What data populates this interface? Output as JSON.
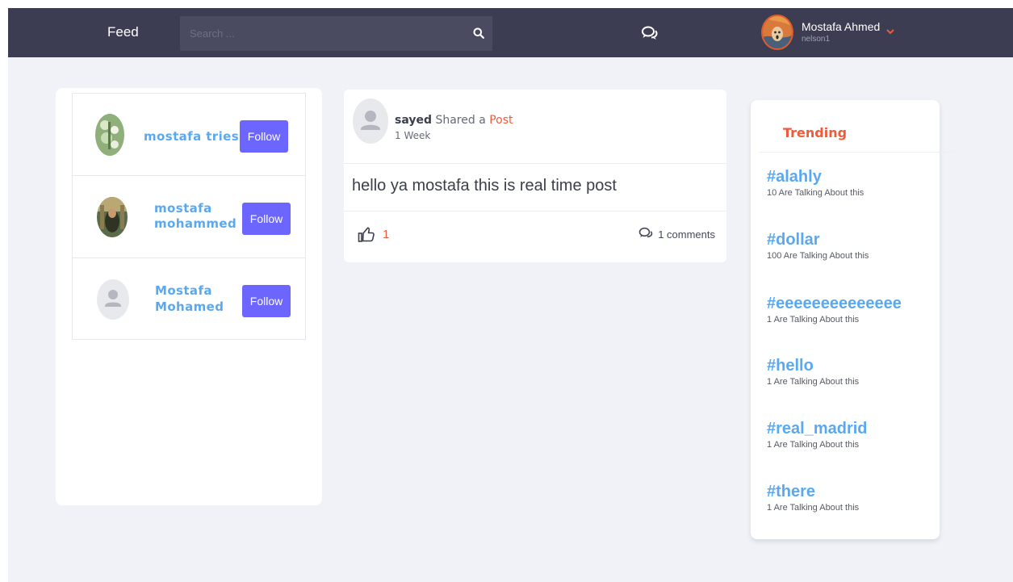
{
  "header": {
    "brand": "Feed",
    "search_placeholder": "Search ...",
    "user": {
      "name": "Mostafa Ahmed",
      "username": "nelson1"
    }
  },
  "suggestions": [
    {
      "name": "mostafa tries",
      "follow_label": "Follow"
    },
    {
      "name_line1": "mostafa",
      "name_line2": "mohammed",
      "follow_label": "Follow"
    },
    {
      "name_line1": "Mostafa",
      "name_line2": "Mohamed",
      "follow_label": "Follow"
    }
  ],
  "post": {
    "author": "sayed",
    "action": "Shared a",
    "type": "Post",
    "time": "1 Week",
    "text": "hello ya mostafa this is real time post",
    "likes": "1",
    "comments": "1 comments"
  },
  "trending": {
    "title": "Trending",
    "items": [
      {
        "tag": "#alahly",
        "count": "10 Are Talking About this"
      },
      {
        "tag": "#dollar",
        "count": "100 Are Talking About this"
      },
      {
        "tag": "#eeeeeeeeeeeeee",
        "count": "1 Are Talking About this"
      },
      {
        "tag": "#hello",
        "count": "1 Are Talking About this"
      },
      {
        "tag": "#real_madrid",
        "count": "1 Are Talking About this"
      },
      {
        "tag": "#there",
        "count": "1 Are Talking About this"
      }
    ]
  },
  "colors": {
    "topbar": "#3c3d53",
    "accent": "#ef5b3a",
    "link": "#5aa9f0",
    "follow": "#6c66ff"
  },
  "icons": {
    "search": "search-icon",
    "chat": "chat-icon",
    "caret": "chevron-down-icon",
    "like": "thumbs-up-icon",
    "comment": "comment-icon"
  }
}
